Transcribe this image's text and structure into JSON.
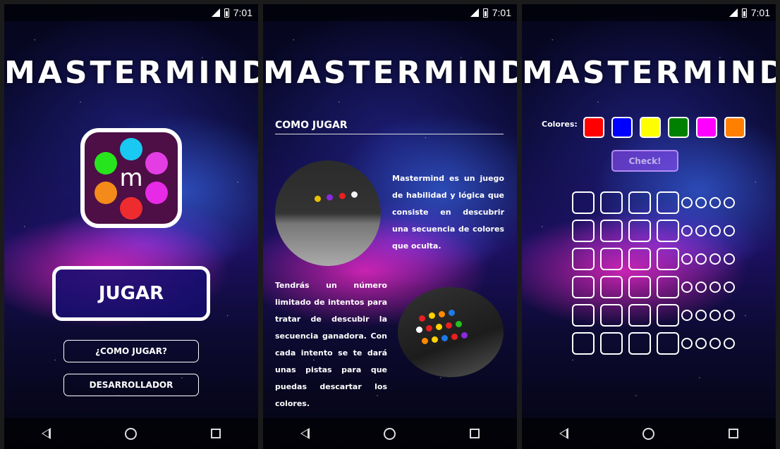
{
  "status_bar": {
    "time": "7:01"
  },
  "screen_home": {
    "title": "MASTERMIND",
    "logo_letter": "m",
    "logo_dot_colors": [
      "#19c9f1",
      "#27e51d",
      "#e23ee4",
      "#f38a1a",
      "#e72ae6",
      "#ee2b2e"
    ],
    "play_label": "JUGAR",
    "how_to_label": "¿COMO JUGAR?",
    "developer_label": "DESARROLLADOR"
  },
  "screen_howto": {
    "title": "MASTERMIND",
    "heading": "COMO JUGAR",
    "paragraph_1": "Mastermind es un juego de habilidad y lógica que consiste en descubrir una secuencia de colores que oculta.",
    "paragraph_2": "Tendrás un número limitado de intentos para tratar de descubir la secuencia ganadora. Con cada intento se te dará unas pistas para que puedas descartar los colores."
  },
  "screen_game": {
    "title": "MASTERMIND",
    "colors_label": "Colores:",
    "colors": [
      "#ff0000",
      "#0000ff",
      "#ffff00",
      "#008000",
      "#ff00ff",
      "#ff8000"
    ],
    "check_label": "Check!",
    "rows": 6,
    "slots_per_row": 4,
    "pins_per_row": 4
  },
  "colors": {
    "accent": "#1a0f6e",
    "logo_bg": "#4d0f45"
  }
}
